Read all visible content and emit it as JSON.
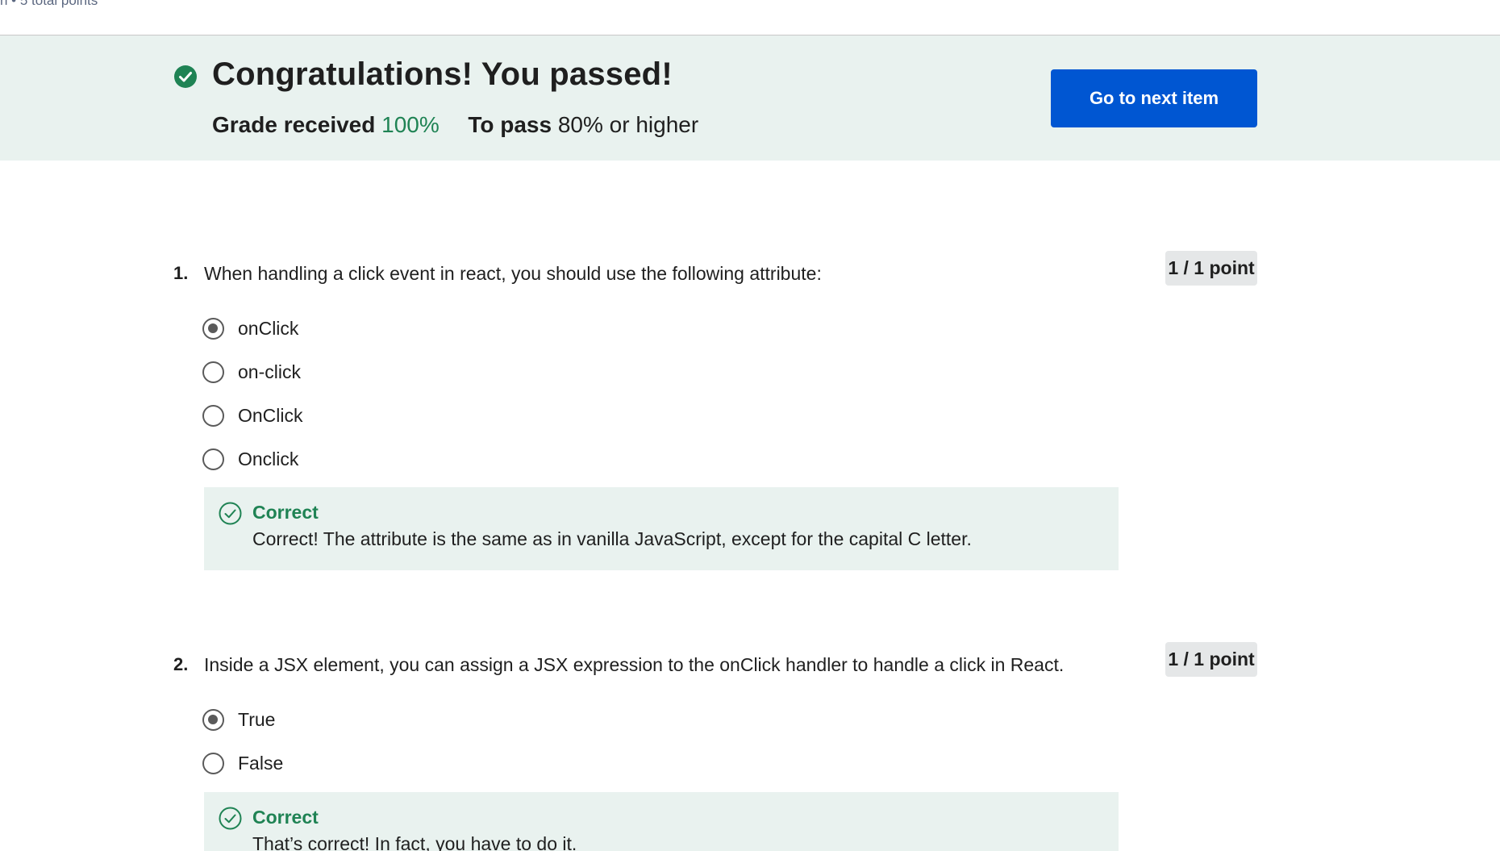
{
  "header": {
    "meta_text": "n • 5 total points"
  },
  "banner": {
    "title": "Congratulations! You passed!",
    "grade_label": "Grade received",
    "grade_value": "100%",
    "pass_label": "To pass",
    "pass_value": "80% or higher",
    "next_button": "Go to next item"
  },
  "colors": {
    "accent": "#0056d2",
    "success": "#1f8354",
    "banner_bg": "#e9f2ef"
  },
  "questions": [
    {
      "number": "1.",
      "text": "When handling a click event in react, you should use the following attribute:",
      "points": "1 / 1 point",
      "options": [
        {
          "label": "onClick",
          "selected": true
        },
        {
          "label": "on-click",
          "selected": false
        },
        {
          "label": "OnClick",
          "selected": false
        },
        {
          "label": "Onclick",
          "selected": false
        }
      ],
      "feedback": {
        "title": "Correct",
        "text": "Correct! The attribute is the same as in vanilla JavaScript, except for the capital C letter."
      }
    },
    {
      "number": "2.",
      "text": "Inside a JSX element, you can assign a JSX expression to the onClick handler to handle a click in React.",
      "points": "1 / 1 point",
      "options": [
        {
          "label": "True",
          "selected": true
        },
        {
          "label": "False",
          "selected": false
        }
      ],
      "feedback": {
        "title": "Correct",
        "text": "That’s correct! In fact, you have to do it."
      }
    }
  ]
}
